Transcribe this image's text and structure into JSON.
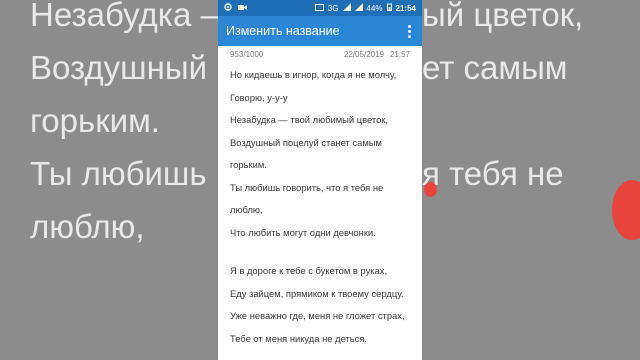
{
  "background": {
    "left_lines": [
      "Незабудка —",
      "Воздушный",
      "горьким.",
      "Ты любишь г",
      "люблю,"
    ],
    "right_lines": [
      "ый цветок,",
      "ет самым",
      "",
      "я тебя не",
      ""
    ]
  },
  "statusbar": {
    "network": "3G",
    "battery": "44%",
    "time": "21:54"
  },
  "appbar": {
    "title": "Изменить название",
    "menu_icon": "more-vert-icon"
  },
  "meta": {
    "count": "953/1000",
    "date": "22/05/2019",
    "time": "21:57"
  },
  "lyrics": {
    "block1": [
      "Но кидаешь в игнор, когда я не молчу,",
      "Говорю, у-у-у",
      "Незабудка — твой любимый цветок,",
      "Воздушный поцелуй станет самым",
      "горьким.",
      "Ты любишь говорить, что я тебя не",
      "люблю,",
      "Что любить могут одни девчонки."
    ],
    "block2": [
      "Я в дороге к тебе с букетом в руках,",
      "Еду зайцем, прямиком к твоему сердцу.",
      "Уже неважно где, меня не гложет страх,",
      "Тебе от меня никуда не деться."
    ]
  },
  "colors": {
    "statusbar": "#1e6fb8",
    "appbar": "#2a86d6",
    "accent_dot": "#e8433c"
  }
}
